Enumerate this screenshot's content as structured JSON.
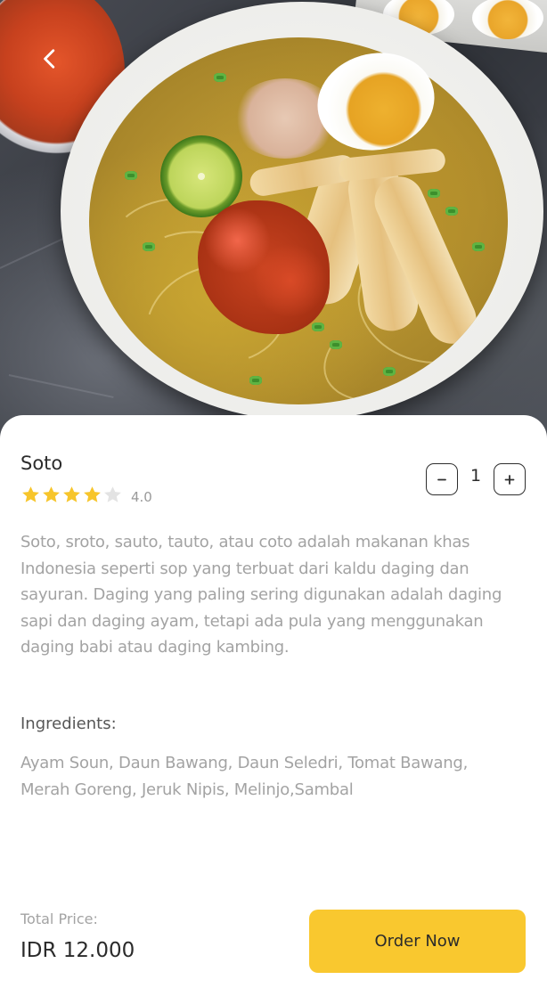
{
  "hero": {
    "image_name": "soto-bowl-photo",
    "back_icon": "chevron-left-icon"
  },
  "item": {
    "name": "Soto",
    "rating": {
      "value": 4,
      "max": 5,
      "label": "4.0"
    },
    "quantity": {
      "value": "1",
      "decrement_icon": "minus-icon",
      "increment_icon": "plus-icon"
    },
    "description": "Soto, sroto, sauto, tauto, atau coto adalah makanan khas Indonesia seperti sop yang terbuat dari kaldu daging dan sayuran. Daging yang paling sering digunakan adalah daging sapi dan daging ayam, tetapi ada pula yang menggunakan daging babi atau daging kambing.",
    "ingredients_heading": "Ingredients:",
    "ingredients": "Ayam Soun, Daun Bawang, Daun Seledri, Tomat Bawang, Merah Goreng, Jeruk Nipis, Melinjo,Sambal"
  },
  "footer": {
    "total_label": "Total Price:",
    "total_value": "IDR 12.000",
    "order_button": "Order Now"
  },
  "colors": {
    "accent": "#f9c82f",
    "star_filled": "#f7c52b",
    "star_empty": "#e3e3e3",
    "text_primary": "#2b2b2b",
    "text_muted": "#a3a3a3"
  }
}
